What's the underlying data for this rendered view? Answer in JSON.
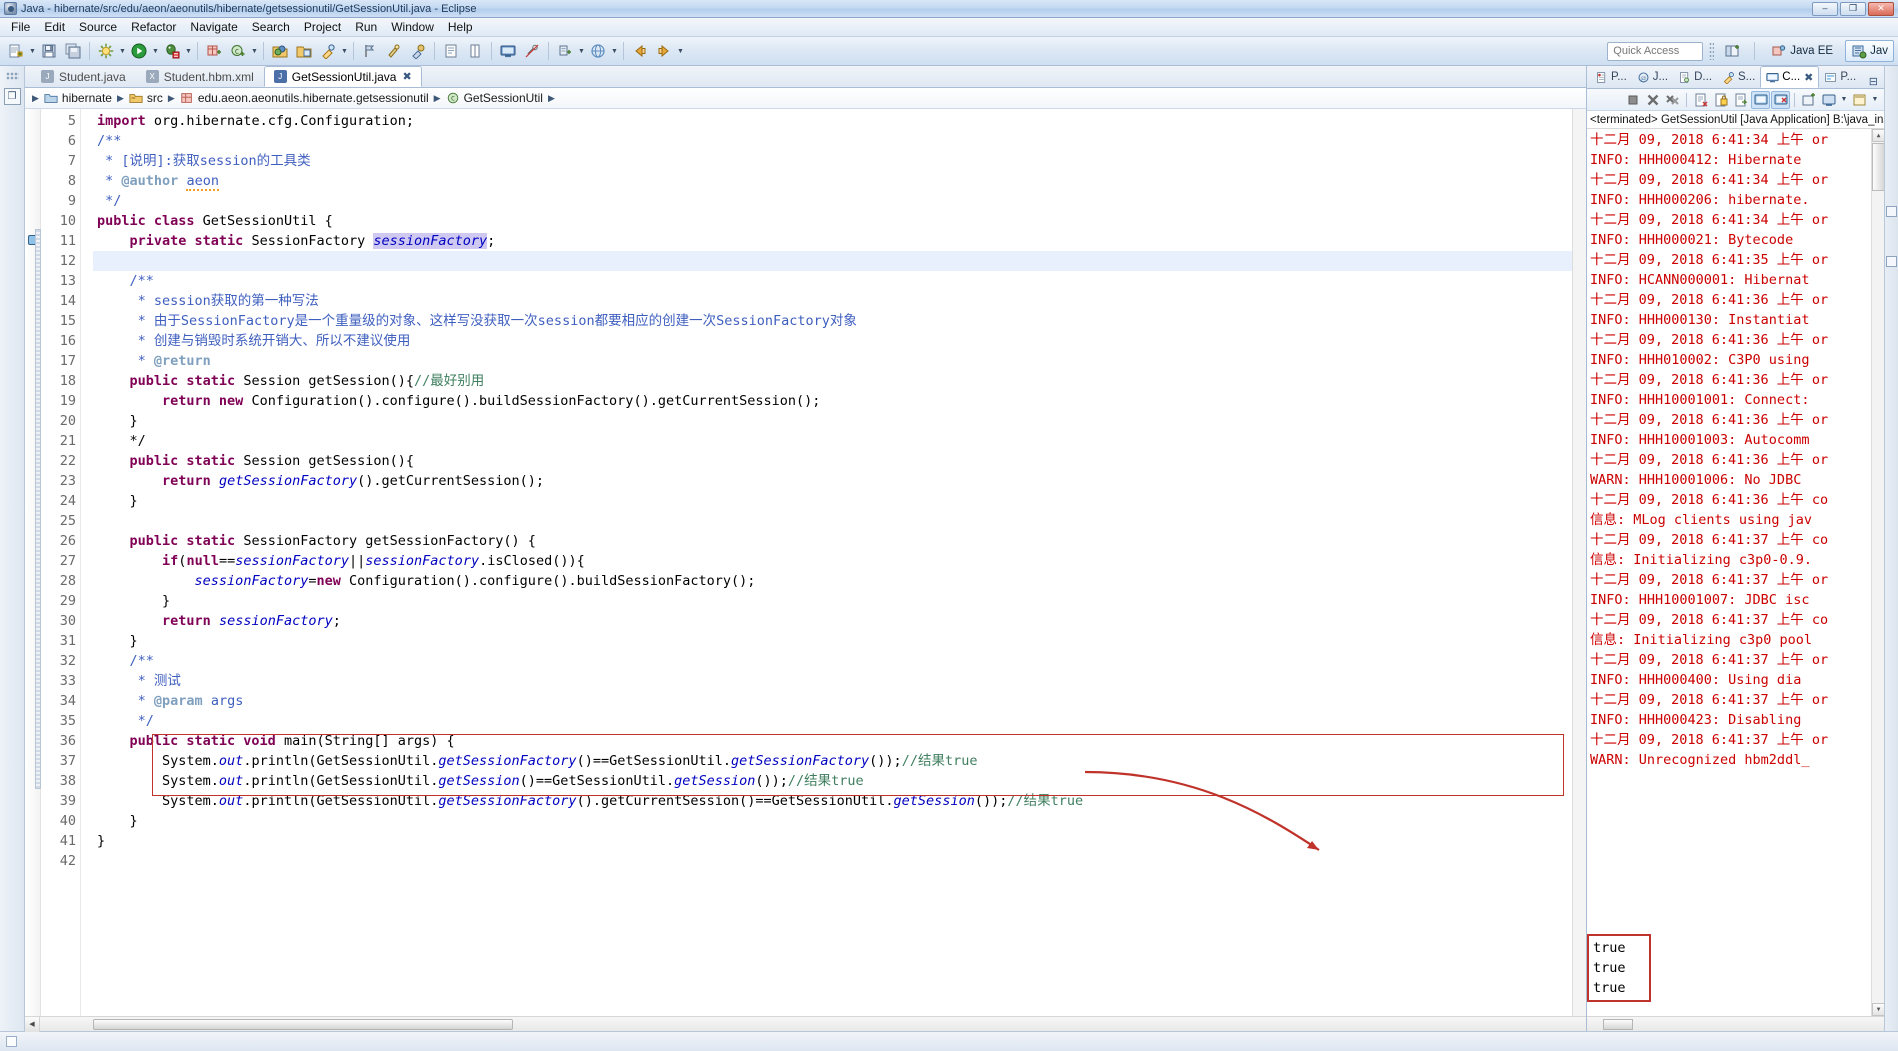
{
  "window": {
    "title": "Java - hibernate/src/edu/aeon/aeonutils/hibernate/getsessionutil/GetSessionUtil.java - Eclipse",
    "app_icon": "eclipse-icon",
    "minimize": "–",
    "maximize": "❐",
    "close": "✕"
  },
  "menubar": {
    "items": [
      "File",
      "Edit",
      "Source",
      "Refactor",
      "Navigate",
      "Search",
      "Project",
      "Run",
      "Window",
      "Help"
    ]
  },
  "toolbar": {
    "quick_access_placeholder": "Quick Access",
    "perspectives": [
      {
        "label": "Java EE",
        "icon": "java-ee-perspective-icon",
        "active": false
      },
      {
        "label": "Jav",
        "icon": "java-perspective-icon",
        "active": true
      }
    ],
    "open_perspective_icon": "open-perspective-icon"
  },
  "editor": {
    "tabs": [
      {
        "label": "Student.java",
        "icon": "java-file-icon",
        "active": false,
        "closable": false
      },
      {
        "label": "Student.hbm.xml",
        "icon": "xml-file-icon",
        "active": false,
        "closable": false
      },
      {
        "label": "GetSessionUtil.java",
        "icon": "java-file-icon",
        "active": true,
        "closable": true
      }
    ],
    "close_glyph": "✖",
    "breadcrumb": [
      {
        "label": "hibernate",
        "icon": "project-icon"
      },
      {
        "label": "src",
        "icon": "source-folder-icon"
      },
      {
        "label": "edu.aeon.aeonutils.hibernate.getsessionutil",
        "icon": "package-icon"
      },
      {
        "label": "GetSessionUtil",
        "icon": "class-icon"
      }
    ],
    "breadcrumb_separator": "▶",
    "first_visible_line": 5,
    "lines": [
      {
        "n": "5",
        "fold": "",
        "hl": false,
        "segs": [
          {
            "t": "import ",
            "c": "kw"
          },
          {
            "t": "org.hibernate.cfg.Configuration;",
            "c": "plain"
          }
        ]
      },
      {
        "n": "6",
        "fold": "⊖",
        "hl": false,
        "segs": [
          {
            "t": "/**",
            "c": "jdoc"
          }
        ]
      },
      {
        "n": "7",
        "fold": "",
        "hl": false,
        "segs": [
          {
            "t": " * ",
            "c": "jdoc"
          },
          {
            "t": "[说明]:获取session的工具类",
            "c": "jdoc"
          }
        ]
      },
      {
        "n": "8",
        "fold": "",
        "hl": false,
        "segs": [
          {
            "t": " * ",
            "c": "jdoc"
          },
          {
            "t": "@author",
            "c": "jdoc-tag"
          },
          {
            "t": " ",
            "c": "jdoc"
          },
          {
            "t": "aeon",
            "c": "jdoc warnu"
          }
        ]
      },
      {
        "n": "9",
        "fold": "",
        "hl": false,
        "segs": [
          {
            "t": " */",
            "c": "jdoc"
          }
        ]
      },
      {
        "n": "10",
        "fold": "",
        "hl": false,
        "segs": [
          {
            "t": "public class ",
            "c": "kw"
          },
          {
            "t": "GetSessionUtil {",
            "c": "plain"
          }
        ]
      },
      {
        "n": "11",
        "fold": "",
        "hl": false,
        "marker": "todo",
        "segs": [
          {
            "t": "    ",
            "c": "plain"
          },
          {
            "t": "private static ",
            "c": "kw"
          },
          {
            "t": "SessionFactory ",
            "c": "plain"
          },
          {
            "t": "sessionFactory",
            "c": "sel-token"
          },
          {
            "t": ";",
            "c": "plain"
          }
        ]
      },
      {
        "n": "12",
        "fold": "",
        "hl": true,
        "segs": [
          {
            "t": "",
            "c": "plain"
          }
        ]
      },
      {
        "n": "13",
        "fold": "⊖",
        "hl": false,
        "segs": [
          {
            "t": "    ",
            "c": "plain"
          },
          {
            "t": "/**",
            "c": "jdoc"
          }
        ]
      },
      {
        "n": "14",
        "fold": "",
        "hl": false,
        "segs": [
          {
            "t": "     * session获取的第一种写法",
            "c": "jdoc"
          }
        ]
      },
      {
        "n": "15",
        "fold": "",
        "hl": false,
        "segs": [
          {
            "t": "     * 由于SessionFactory是一个重量级的对象、这样写没获取一次session都要相应的创建一次SessionFactory对象",
            "c": "jdoc"
          }
        ]
      },
      {
        "n": "16",
        "fold": "",
        "hl": false,
        "segs": [
          {
            "t": "     * 创建与销毁时系统开销大、所以不建议使用",
            "c": "jdoc"
          }
        ]
      },
      {
        "n": "17",
        "fold": "",
        "hl": false,
        "segs": [
          {
            "t": "     * ",
            "c": "jdoc"
          },
          {
            "t": "@return",
            "c": "jdoc-tag"
          }
        ]
      },
      {
        "n": "18",
        "fold": "",
        "hl": false,
        "segs": [
          {
            "t": "    ",
            "c": "jdoc"
          },
          {
            "t": "public static ",
            "c": "kw"
          },
          {
            "t": "Session ",
            "c": "plain"
          },
          {
            "t": "getSession(){",
            "c": "plain"
          },
          {
            "t": "//最好别用",
            "c": "cmt"
          }
        ]
      },
      {
        "n": "19",
        "fold": "",
        "hl": false,
        "segs": [
          {
            "t": "        ",
            "c": "plain"
          },
          {
            "t": "return new ",
            "c": "kw"
          },
          {
            "t": "Configuration().configure().buildSessionFactory().getCurrentSession();",
            "c": "plain"
          }
        ]
      },
      {
        "n": "20",
        "fold": "",
        "hl": false,
        "segs": [
          {
            "t": "    }",
            "c": "plain"
          }
        ]
      },
      {
        "n": "21",
        "fold": "",
        "hl": false,
        "segs": [
          {
            "t": "    */",
            "c": "plain"
          }
        ]
      },
      {
        "n": "22",
        "fold": "⊖",
        "hl": false,
        "segs": [
          {
            "t": "    ",
            "c": "plain"
          },
          {
            "t": "public static ",
            "c": "kw"
          },
          {
            "t": "Session getSession(){",
            "c": "plain"
          }
        ]
      },
      {
        "n": "23",
        "fold": "",
        "hl": false,
        "segs": [
          {
            "t": "        ",
            "c": "plain"
          },
          {
            "t": "return ",
            "c": "kw"
          },
          {
            "t": "getSessionFactory",
            "c": "fld"
          },
          {
            "t": "().getCurrentSession();",
            "c": "plain"
          }
        ]
      },
      {
        "n": "24",
        "fold": "",
        "hl": false,
        "segs": [
          {
            "t": "    }",
            "c": "plain"
          }
        ]
      },
      {
        "n": "25",
        "fold": "",
        "hl": false,
        "segs": [
          {
            "t": "",
            "c": "plain"
          }
        ]
      },
      {
        "n": "26",
        "fold": "⊖",
        "hl": false,
        "segs": [
          {
            "t": "    ",
            "c": "plain"
          },
          {
            "t": "public static ",
            "c": "kw"
          },
          {
            "t": "SessionFactory getSessionFactory() {",
            "c": "plain"
          }
        ]
      },
      {
        "n": "27",
        "fold": "",
        "hl": false,
        "segs": [
          {
            "t": "        ",
            "c": "plain"
          },
          {
            "t": "if",
            "c": "kw"
          },
          {
            "t": "(",
            "c": "plain"
          },
          {
            "t": "null",
            "c": "kw"
          },
          {
            "t": "==",
            "c": "plain"
          },
          {
            "t": "sessionFactory",
            "c": "fld"
          },
          {
            "t": "||",
            "c": "plain"
          },
          {
            "t": "sessionFactory",
            "c": "fld"
          },
          {
            "t": ".isClosed()){",
            "c": "plain"
          }
        ]
      },
      {
        "n": "28",
        "fold": "",
        "hl": false,
        "segs": [
          {
            "t": "            ",
            "c": "plain"
          },
          {
            "t": "sessionFactory",
            "c": "fld"
          },
          {
            "t": "=",
            "c": "plain"
          },
          {
            "t": "new ",
            "c": "kw"
          },
          {
            "t": "Configuration().configure().buildSessionFactory();",
            "c": "plain"
          }
        ]
      },
      {
        "n": "29",
        "fold": "",
        "hl": false,
        "segs": [
          {
            "t": "        }",
            "c": "plain"
          }
        ]
      },
      {
        "n": "30",
        "fold": "",
        "hl": false,
        "segs": [
          {
            "t": "        ",
            "c": "plain"
          },
          {
            "t": "return ",
            "c": "kw"
          },
          {
            "t": "sessionFactory",
            "c": "fld"
          },
          {
            "t": ";",
            "c": "plain"
          }
        ]
      },
      {
        "n": "31",
        "fold": "",
        "hl": false,
        "segs": [
          {
            "t": "    }",
            "c": "plain"
          }
        ]
      },
      {
        "n": "32",
        "fold": "⊖",
        "hl": false,
        "segs": [
          {
            "t": "    ",
            "c": "plain"
          },
          {
            "t": "/**",
            "c": "jdoc"
          }
        ]
      },
      {
        "n": "33",
        "fold": "",
        "hl": false,
        "segs": [
          {
            "t": "     * 测试",
            "c": "jdoc"
          }
        ]
      },
      {
        "n": "34",
        "fold": "",
        "hl": false,
        "segs": [
          {
            "t": "     * ",
            "c": "jdoc"
          },
          {
            "t": "@param",
            "c": "jdoc-tag"
          },
          {
            "t": " args",
            "c": "jdoc"
          }
        ]
      },
      {
        "n": "35",
        "fold": "",
        "hl": false,
        "segs": [
          {
            "t": "     */",
            "c": "jdoc"
          }
        ]
      },
      {
        "n": "36",
        "fold": "⊖",
        "hl": false,
        "segs": [
          {
            "t": "    ",
            "c": "plain"
          },
          {
            "t": "public static void ",
            "c": "kw"
          },
          {
            "t": "main(String[] args) {",
            "c": "plain"
          }
        ]
      },
      {
        "n": "37",
        "fold": "",
        "hl": false,
        "segs": [
          {
            "t": "        System.",
            "c": "plain"
          },
          {
            "t": "out",
            "c": "fld"
          },
          {
            "t": ".println(GetSessionUtil.",
            "c": "plain"
          },
          {
            "t": "getSessionFactory",
            "c": "fld"
          },
          {
            "t": "()==GetSessionUtil.",
            "c": "plain"
          },
          {
            "t": "getSessionFactory",
            "c": "fld"
          },
          {
            "t": "());",
            "c": "plain"
          },
          {
            "t": "//结果true",
            "c": "cmt"
          }
        ]
      },
      {
        "n": "38",
        "fold": "",
        "hl": false,
        "segs": [
          {
            "t": "        System.",
            "c": "plain"
          },
          {
            "t": "out",
            "c": "fld"
          },
          {
            "t": ".println(GetSessionUtil.",
            "c": "plain"
          },
          {
            "t": "getSession",
            "c": "fld"
          },
          {
            "t": "()==GetSessionUtil.",
            "c": "plain"
          },
          {
            "t": "getSession",
            "c": "fld"
          },
          {
            "t": "());",
            "c": "plain"
          },
          {
            "t": "//结果true",
            "c": "cmt"
          }
        ]
      },
      {
        "n": "39",
        "fold": "",
        "hl": false,
        "segs": [
          {
            "t": "        System.",
            "c": "plain"
          },
          {
            "t": "out",
            "c": "fld"
          },
          {
            "t": ".println(GetSessionUtil.",
            "c": "plain"
          },
          {
            "t": "getSessionFactory",
            "c": "fld"
          },
          {
            "t": "().getCurrentSession()==GetSessionUtil.",
            "c": "plain"
          },
          {
            "t": "getSession",
            "c": "fld"
          },
          {
            "t": "());",
            "c": "plain"
          },
          {
            "t": "//结果true",
            "c": "cmt"
          }
        ]
      },
      {
        "n": "40",
        "fold": "",
        "hl": false,
        "segs": [
          {
            "t": "    }",
            "c": "plain"
          }
        ]
      },
      {
        "n": "41",
        "fold": "",
        "hl": false,
        "segs": [
          {
            "t": "}",
            "c": "plain"
          }
        ]
      },
      {
        "n": "42",
        "fold": "",
        "hl": false,
        "segs": [
          {
            "t": "",
            "c": "plain"
          }
        ]
      }
    ],
    "annotation": {
      "box_color": "#c0332b",
      "arrow_color": "#c0332b"
    }
  },
  "console_panel": {
    "tabs": [
      {
        "label": "P...",
        "icon": "problems-icon",
        "active": false
      },
      {
        "label": "J...",
        "icon": "javadoc-icon",
        "active": false
      },
      {
        "label": "D...",
        "icon": "declaration-icon",
        "active": false
      },
      {
        "label": "S...",
        "icon": "search-icon",
        "active": false
      },
      {
        "label": "C...",
        "icon": "console-icon",
        "active": true
      },
      {
        "label": "P...",
        "icon": "progress-icon",
        "active": false
      }
    ],
    "close_glyph": "✖",
    "minimize_glyph": "⊟",
    "toolbar_icons": [
      "terminate-icon",
      "remove-launch-icon",
      "remove-all-terminated-icon",
      "clear-console-icon",
      "scroll-lock-icon",
      "word-wrap-icon",
      "show-console-on-output-icon",
      "pin-console-icon",
      "display-selected-console-icon",
      "open-console-icon",
      "view-menu-icon"
    ],
    "status": "<terminated> GetSessionUtil [Java Application] B:\\java_ins",
    "lines": [
      "十二月 09, 2018 6:41:34 上午 or",
      "INFO: HHH000412: Hibernate",
      "十二月 09, 2018 6:41:34 上午 or",
      "INFO: HHH000206: hibernate.",
      "十二月 09, 2018 6:41:34 上午 or",
      "INFO: HHH000021: Bytecode ",
      "十二月 09, 2018 6:41:35 上午 or",
      "INFO: HCANN000001: Hibernat",
      "十二月 09, 2018 6:41:36 上午 or",
      "INFO: HHH000130: Instantiat",
      "十二月 09, 2018 6:41:36 上午 or",
      "INFO: HHH010002: C3P0 using",
      "十二月 09, 2018 6:41:36 上午 or",
      "INFO: HHH10001001: Connect:",
      "十二月 09, 2018 6:41:36 上午 or",
      "INFO: HHH10001003: Autocomm",
      "十二月 09, 2018 6:41:36 上午 or",
      "WARN: HHH10001006: No JDBC ",
      "十二月 09, 2018 6:41:36 上午 co",
      "信息: MLog clients using jav",
      "十二月 09, 2018 6:41:37 上午 co",
      "信息: Initializing c3p0-0.9.",
      "十二月 09, 2018 6:41:37 上午 or",
      "INFO: HHH10001007: JDBC isc",
      "十二月 09, 2018 6:41:37 上午 co",
      "信息: Initializing c3p0 pool",
      "十二月 09, 2018 6:41:37 上午 or",
      "INFO: HHH000400: Using dia",
      "十二月 09, 2018 6:41:37 上午 or",
      "INFO: HHH000423: Disabling",
      "十二月 09, 2018 6:41:37 上午 or",
      "WARN: Unrecognized hbm2ddl_"
    ],
    "result_values": [
      "true",
      "true",
      "true"
    ]
  }
}
